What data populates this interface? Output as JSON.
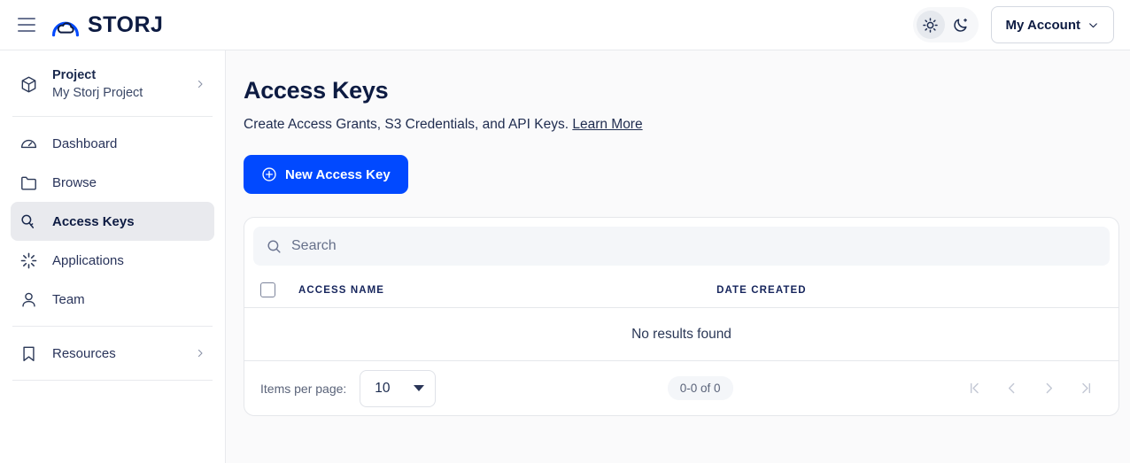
{
  "topbar": {
    "menu_icon": "hamburger-icon",
    "logo_text": "STORJ",
    "theme": {
      "light_icon": "sun-icon",
      "dark_icon": "moon-icon",
      "active": "light"
    },
    "account_label": "My Account",
    "account_chevron": "chevron-down-icon"
  },
  "sidebar": {
    "project": {
      "icon": "cube-icon",
      "title": "Project",
      "name": "My Storj Project",
      "chevron": "chevron-right-icon"
    },
    "items": [
      {
        "label": "Dashboard",
        "icon": "gauge-icon",
        "active": false
      },
      {
        "label": "Browse",
        "icon": "folder-icon",
        "active": false
      },
      {
        "label": "Access Keys",
        "icon": "key-icon",
        "active": true
      },
      {
        "label": "Applications",
        "icon": "sparkle-icon",
        "active": false
      },
      {
        "label": "Team",
        "icon": "user-icon",
        "active": false
      }
    ],
    "resources": {
      "label": "Resources",
      "icon": "bookmark-icon",
      "chevron": "chevron-right-icon"
    }
  },
  "main": {
    "title": "Access Keys",
    "subtitle": "Create Access Grants, S3 Credentials, and API Keys.",
    "learn_more": "Learn More",
    "new_key_button": {
      "label": "New Access Key",
      "icon": "plus-circle-icon"
    },
    "search": {
      "placeholder": "Search",
      "value": "",
      "icon": "search-icon"
    },
    "table": {
      "columns": [
        "ACCESS NAME",
        "DATE CREATED"
      ],
      "rows": [],
      "empty_text": "No results found"
    },
    "pagination": {
      "items_per_page_label": "Items per page:",
      "items_per_page_value": "10",
      "range_text": "0-0 of 0",
      "buttons": [
        {
          "name": "first-page",
          "icon": "first-page-icon"
        },
        {
          "name": "previous-page",
          "icon": "chevron-left-icon"
        },
        {
          "name": "next-page",
          "icon": "chevron-right-icon"
        },
        {
          "name": "last-page",
          "icon": "last-page-icon"
        }
      ]
    }
  },
  "colors": {
    "accent_blue": "#0149ff",
    "navy": "#0d1b42",
    "page_bg": "#fafafb",
    "active_nav_bg": "#e9eaee"
  }
}
